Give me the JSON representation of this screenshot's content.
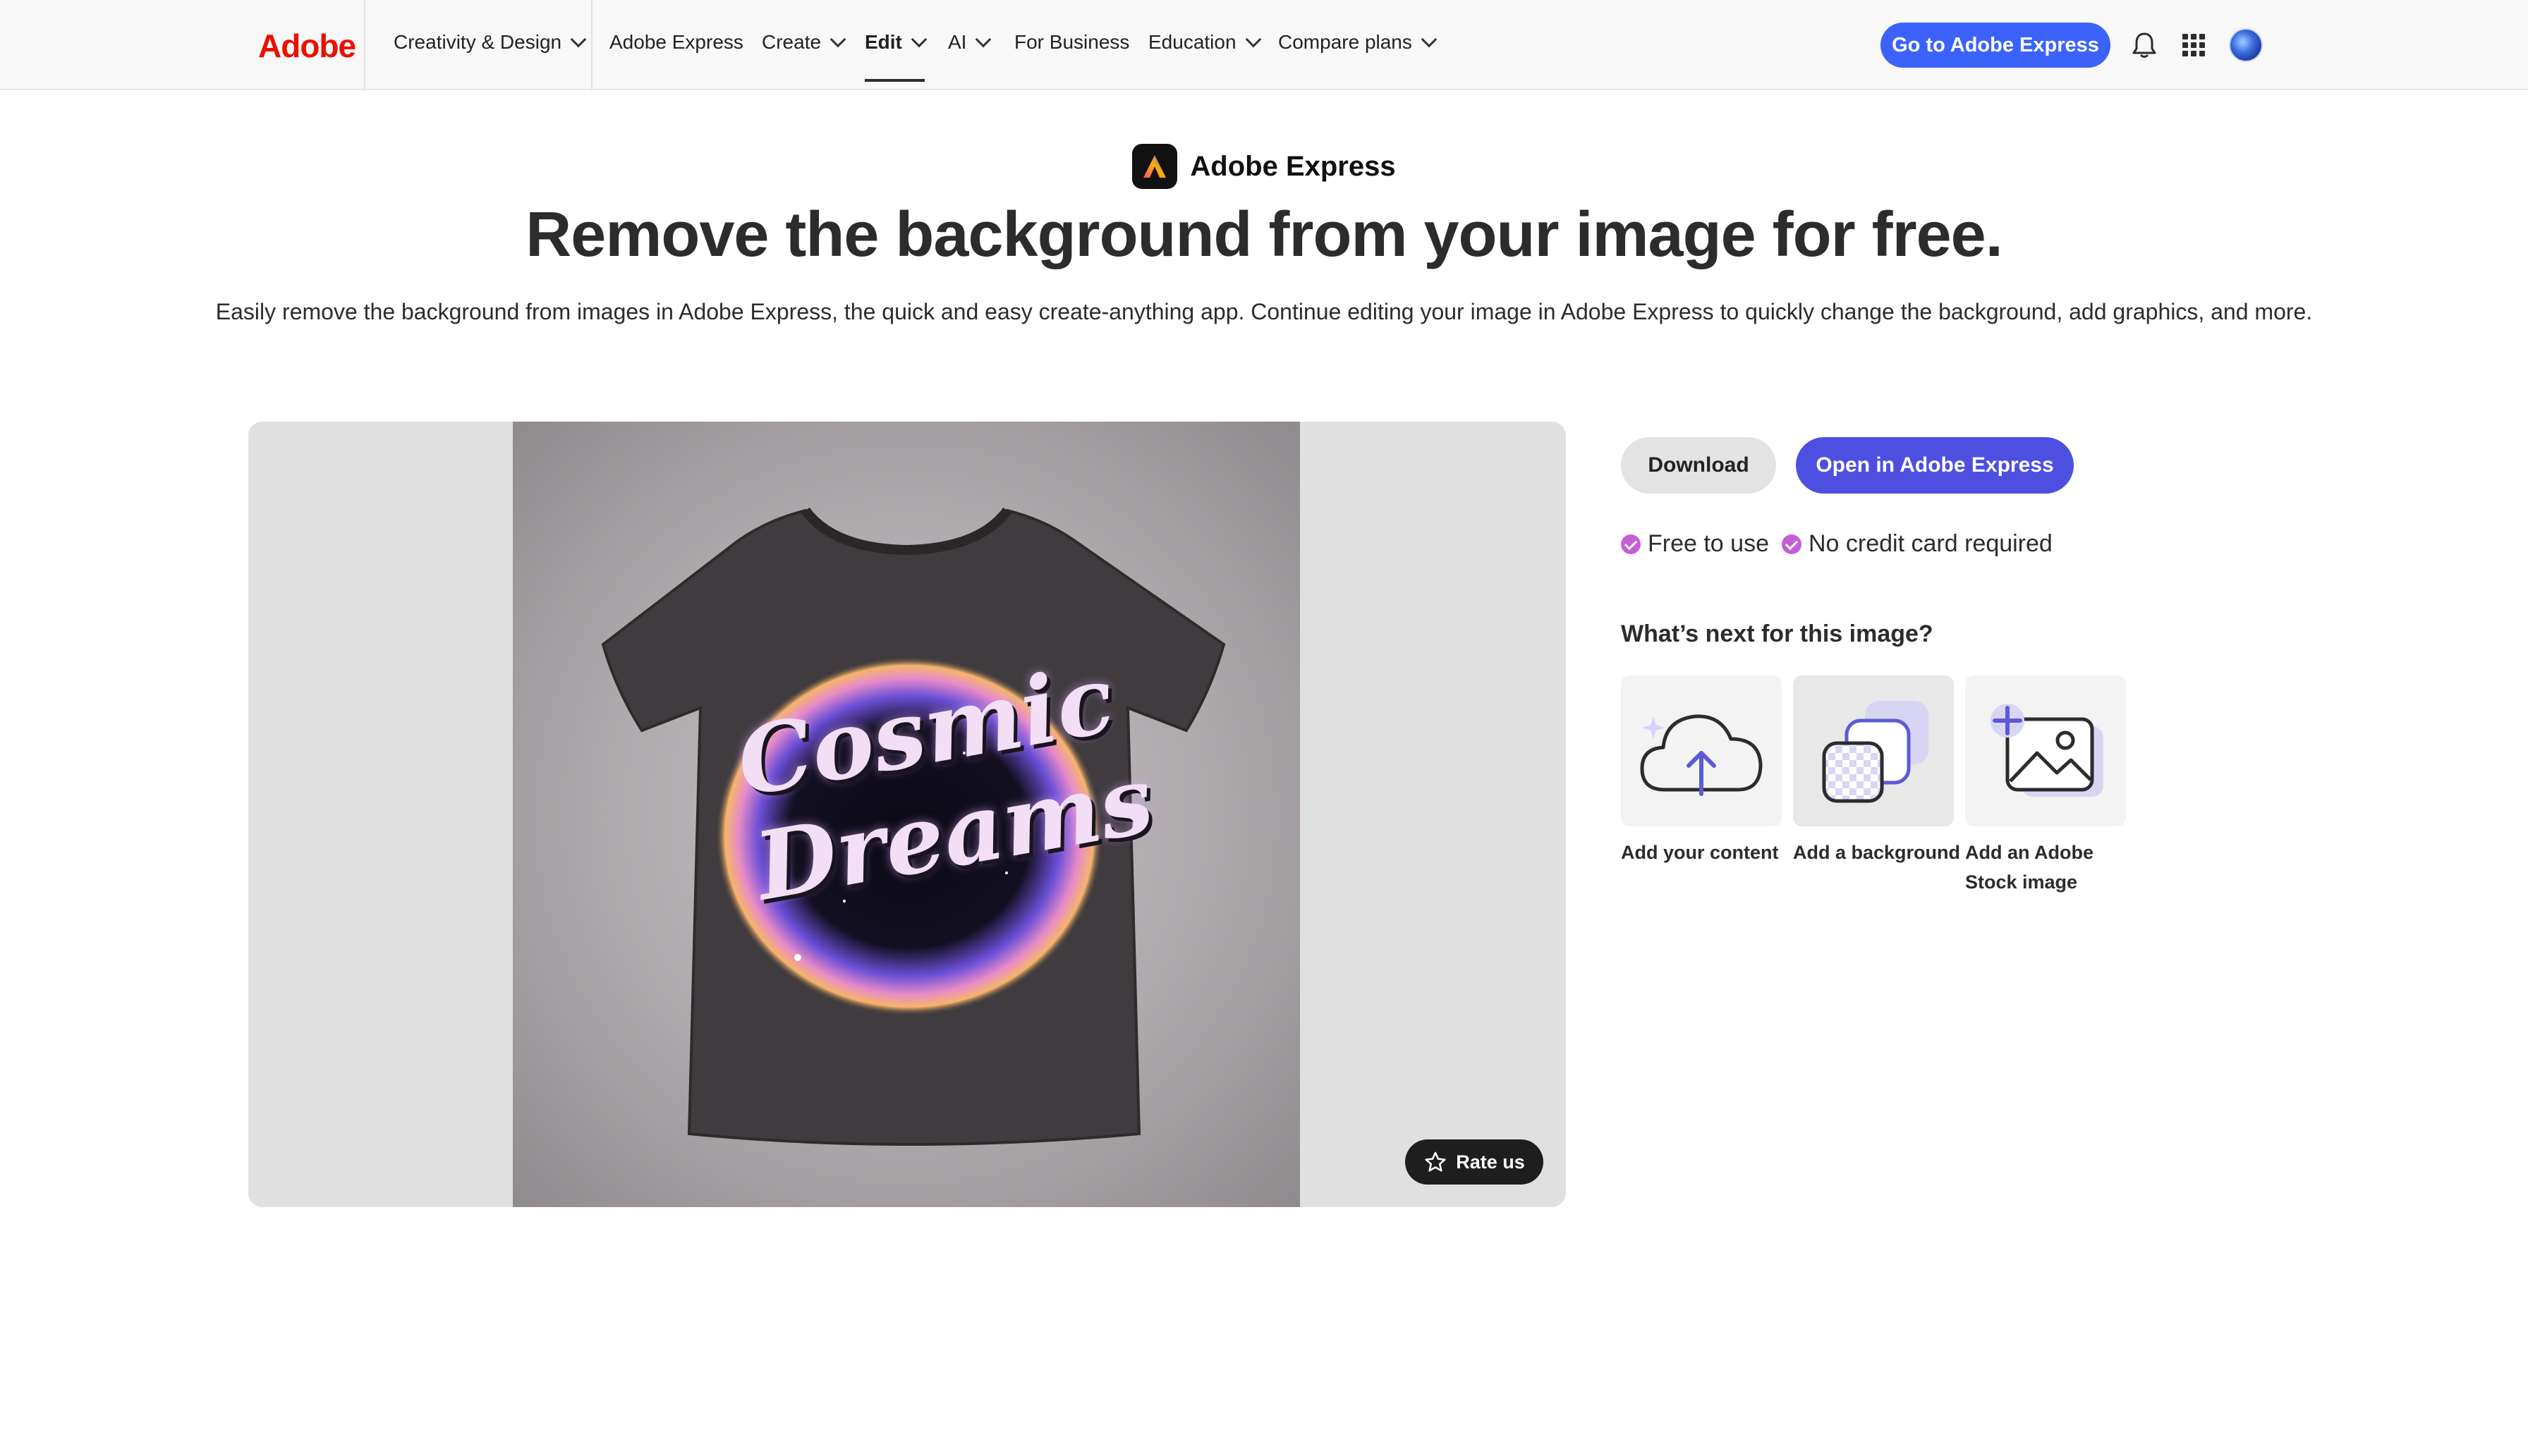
{
  "nav": {
    "brand": "Adobe",
    "items": [
      {
        "label": "Creativity & Design",
        "dropdown": true
      },
      {
        "label": "Adobe Express",
        "dropdown": false
      },
      {
        "label": "Create",
        "dropdown": true
      },
      {
        "label": "Edit",
        "dropdown": true,
        "active": true
      },
      {
        "label": "AI",
        "dropdown": true
      },
      {
        "label": "For Business",
        "dropdown": false
      },
      {
        "label": "Education",
        "dropdown": true
      },
      {
        "label": "Compare plans",
        "dropdown": true
      }
    ],
    "cta": "Go to Adobe Express",
    "icons": [
      "bell-icon",
      "app-grid-icon",
      "avatar"
    ]
  },
  "hero": {
    "product_name": "Adobe Express",
    "title": "Remove the background from your image for free.",
    "description": "Easily remove the background from images in Adobe Express, the quick and easy create-anything app. Continue editing your image in Adobe Express to quickly change the background, add graphics, and more."
  },
  "preview": {
    "image_text": [
      "Cosmic",
      "Dreams"
    ],
    "rate_label": "Rate us"
  },
  "actions": {
    "download": "Download",
    "open": "Open in Adobe Express"
  },
  "badges": [
    "Free to use",
    "No credit card required"
  ],
  "next": {
    "title": "What’s next for this image?",
    "options": [
      {
        "label": "Add your content",
        "icon": "cloud-upload-icon"
      },
      {
        "label": "Add a background",
        "icon": "layered-background-icon"
      },
      {
        "label_line1": "Add an Adobe",
        "label_line2": "Stock image",
        "icon": "add-image-icon"
      }
    ]
  },
  "colors": {
    "accent": "#3b63fb",
    "open_button": "#4d4fe0",
    "brand_red": "#eb1000",
    "check": "#c55fd6"
  }
}
